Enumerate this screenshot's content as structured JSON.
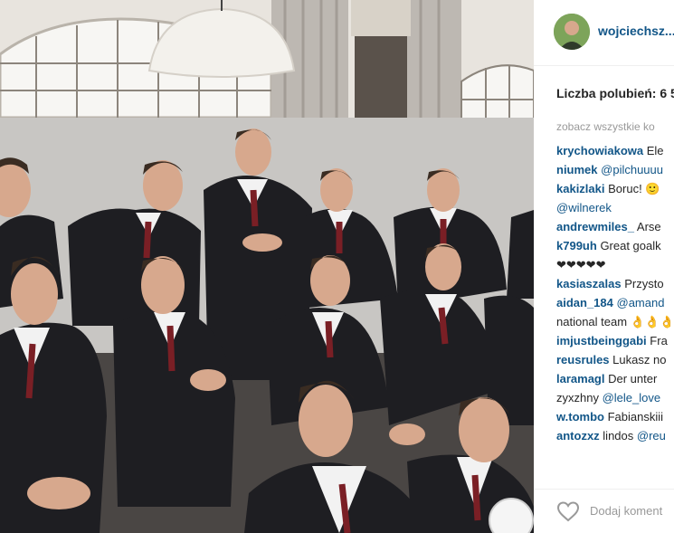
{
  "post": {
    "username": "wojciechsz...",
    "likes_text": "Liczba polubień: 6 5",
    "see_all_text": "zobacz wszystkie ko"
  },
  "comments": [
    {
      "user": "krychowiakowa",
      "text": "Ele"
    },
    {
      "user": "niumek",
      "mention": "@pilchuuuu"
    },
    {
      "user": "kakizlaki",
      "text": "Boruc! 🙂"
    },
    {
      "mention": "@wilnerek"
    },
    {
      "user": "andrewmiles_",
      "text": "Arse"
    },
    {
      "user": "k799uh",
      "text": "Great goalk"
    },
    {
      "text": "❤❤❤❤❤"
    },
    {
      "user": "kasiaszalas",
      "text": "Przysto"
    },
    {
      "user": "aidan_184",
      "mention": "@amand"
    },
    {
      "text": "national team 👌👌👌"
    },
    {
      "user": "imjustbeinggabi",
      "text": "Fra"
    },
    {
      "user": "reusrules",
      "text": "Lukasz no"
    },
    {
      "user": "laramagl",
      "text": "Der unter"
    },
    {
      "text": "zyxzhny",
      "mention": "@lele_love"
    },
    {
      "user": "w.tombo",
      "text": "Fabianskiii"
    },
    {
      "user": "antozxz",
      "text": "lindos",
      "mention": "@reu"
    }
  ],
  "footer": {
    "add_comment_placeholder": "Dodaj koment"
  },
  "icons": {
    "heart": "heart-icon",
    "avatar": "avatar"
  },
  "colors": {
    "username": "#125688",
    "text": "#262626",
    "muted": "#999999"
  }
}
